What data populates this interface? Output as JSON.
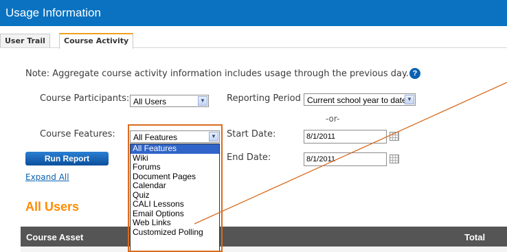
{
  "header": {
    "title": "Usage Information"
  },
  "tabs": [
    {
      "label": "User Trail",
      "active": false
    },
    {
      "label": "Course Activity",
      "active": true
    }
  ],
  "note": {
    "text": "Note: Aggregate course activity information includes usage through the previous day.",
    "help_icon": "question-mark-icon",
    "help_symbol": "?"
  },
  "form": {
    "participants": {
      "label": "Course Participants:",
      "value": "All Users"
    },
    "reporting_period": {
      "label": "Reporting Period",
      "value": "Current school year to date"
    },
    "or_text": "-or-",
    "features": {
      "label": "Course Features:",
      "value": "All Features",
      "options": [
        "All Features",
        "Wiki",
        "Forums",
        "Document Pages",
        "Calendar",
        "Quiz",
        "CALI Lessons",
        "Email Options",
        "Web Links",
        "Customized Polling"
      ],
      "selected_index": 0
    },
    "start_date": {
      "label": "Start Date:",
      "value": "8/1/2011"
    },
    "end_date": {
      "label": "End Date:",
      "value": "8/1/2011"
    },
    "run_report": "Run Report",
    "expand_all": "Expand All"
  },
  "section": {
    "title": "All Users"
  },
  "table": {
    "col_asset": "Course Asset",
    "col_total": "Total"
  },
  "colors": {
    "header_bg": "#0a72c0",
    "accent_orange": "#ff8c00",
    "highlight": "#d86a1e",
    "selection": "#3064c8"
  }
}
